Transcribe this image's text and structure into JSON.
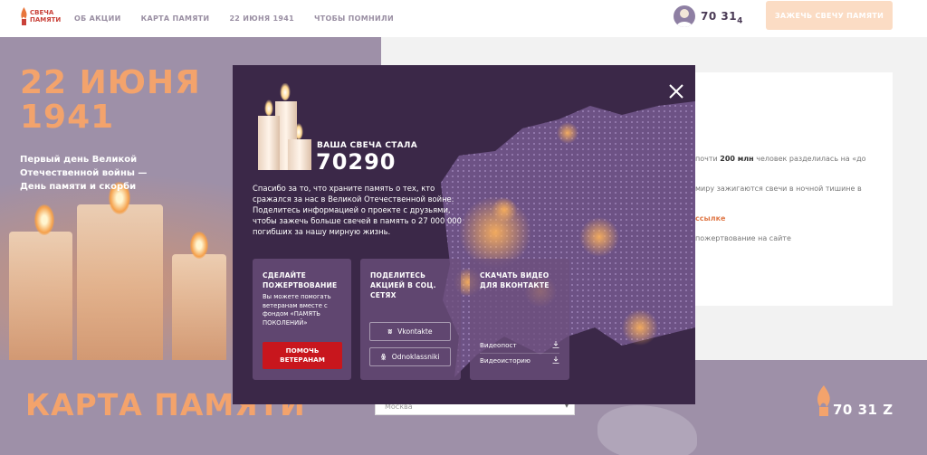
{
  "header": {
    "logo_text": "Свеча памяти",
    "nav": [
      "Об акции",
      "Карта памяти",
      "22 июня 1941",
      "Чтобы помнили"
    ],
    "counter": "70 31",
    "counter_rolling": "4",
    "cta": "Зажечь свечу памяти"
  },
  "hero": {
    "title": "22 ИЮНЯ 1941",
    "subtitle": "Первый день Великой Отечественной войны — День памяти и скорби"
  },
  "background_text": {
    "line1_prefix": "почти",
    "line1_bold": "200 млн",
    "line1_suffix": "человек разделилась на «до",
    "line2": "миру зажигаются свечи в ночной тишине в",
    "line3": "ссылке",
    "line4": "пожертвование на сайте"
  },
  "bottom": {
    "title": "КАРТА ПАМЯТИ",
    "city_value": "Москва",
    "counter": "70 31",
    "counter_rolling": "Z"
  },
  "modal": {
    "label": "Ваша свеча стала",
    "number": "70290",
    "text": "Спасибо за то, что храните память о тех, кто сражался за нас в Великой Отечественной войне. Поделитесь информацией о проекте с друзьями, чтобы зажечь больше свечей в память о 27 000 000 погибших за нашу мирную жизнь.",
    "donate": {
      "title": "Сделайте пожертвование",
      "body": "Вы можете помогать ветеранам вместе с фондом «ПАМЯТЬ ПОКОЛЕНИЙ»",
      "button": "Помочь ветеранам"
    },
    "share": {
      "title": "Поделитесь акцией в соц. сетях",
      "vk": "Vkontakte",
      "ok": "Odnoklassniki"
    },
    "download": {
      "title": "Скачать видео для вконтакте",
      "post": "Видеопост",
      "story": "Видеоисторию"
    }
  },
  "colors": {
    "accent_orange": "#f3a36c",
    "modal_bg": "#3b2848",
    "lilac": "#9e90a8",
    "red_button": "#c8161d"
  }
}
